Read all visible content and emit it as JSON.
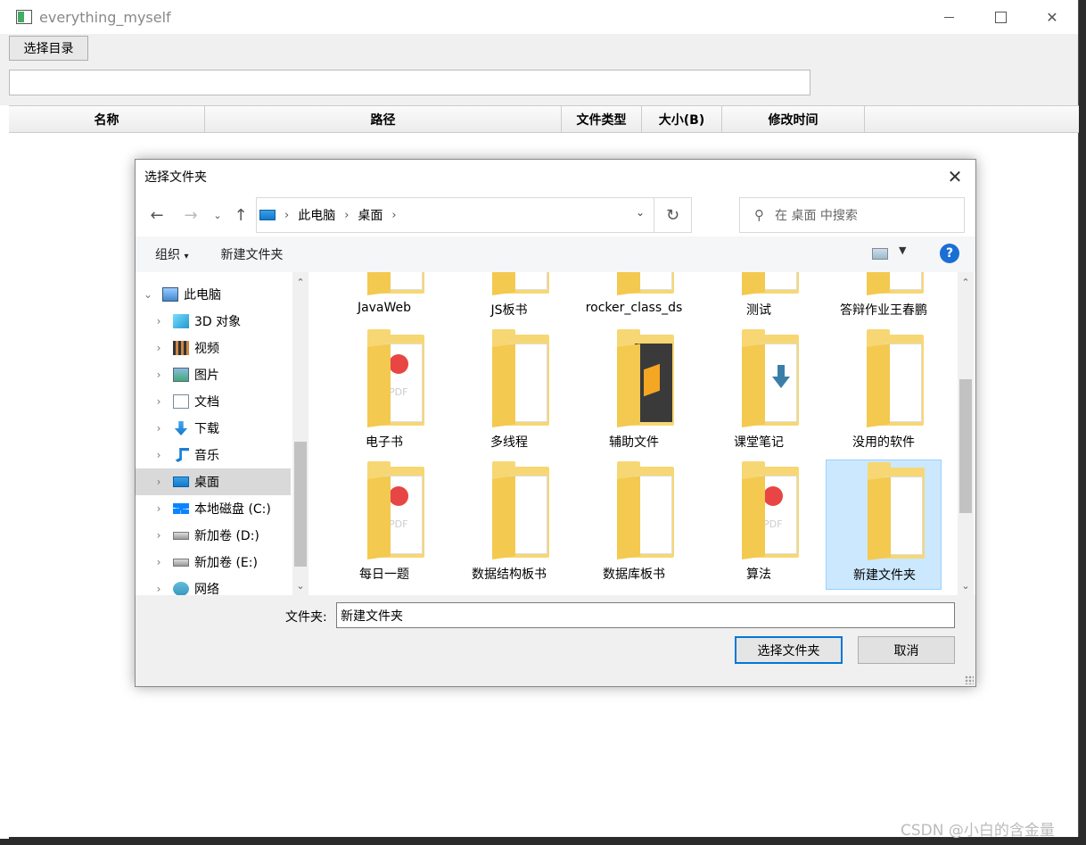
{
  "window": {
    "title": "everything_myself",
    "select_dir_label": "选择目录",
    "columns": [
      "名称",
      "路径",
      "文件类型",
      "大小(B)",
      "修改时间"
    ]
  },
  "dialog": {
    "title": "选择文件夹",
    "breadcrumb": [
      "此电脑",
      "桌面"
    ],
    "search_placeholder": "在 桌面 中搜索",
    "commands": {
      "organize": "组织",
      "new_folder": "新建文件夹"
    },
    "help_glyph": "?",
    "nav_tree": [
      {
        "label": "此电脑",
        "icon": "computer-icon",
        "expanded": true
      },
      {
        "label": "3D 对象",
        "icon": "cube-icon"
      },
      {
        "label": "视频",
        "icon": "video-icon"
      },
      {
        "label": "图片",
        "icon": "picture-icon"
      },
      {
        "label": "文档",
        "icon": "document-icon"
      },
      {
        "label": "下载",
        "icon": "download-icon"
      },
      {
        "label": "音乐",
        "icon": "music-icon"
      },
      {
        "label": "桌面",
        "icon": "desktop-icon",
        "selected": true
      },
      {
        "label": "本地磁盘 (C:)",
        "icon": "windows-drive-icon"
      },
      {
        "label": "新加卷 (D:)",
        "icon": "drive-icon"
      },
      {
        "label": "新加卷 (E:)",
        "icon": "drive-icon"
      },
      {
        "label": "网络",
        "icon": "network-icon"
      }
    ],
    "files": [
      {
        "label": "JavaWeb",
        "icon": "folder-icon"
      },
      {
        "label": "JS板书",
        "icon": "folder-icon"
      },
      {
        "label": "rocker_class_ds",
        "icon": "folder-icon"
      },
      {
        "label": "测试",
        "icon": "folder-icon"
      },
      {
        "label": "答辩作业王春鹏",
        "icon": "folder-icon"
      },
      {
        "label": "电子书",
        "icon": "folder-pdf-icon"
      },
      {
        "label": "多线程",
        "icon": "folder-icon"
      },
      {
        "label": "辅助文件",
        "icon": "folder-sublime-icon"
      },
      {
        "label": "课堂笔记",
        "icon": "folder-download-icon"
      },
      {
        "label": "没用的软件",
        "icon": "folder-icon"
      },
      {
        "label": "每日一题",
        "icon": "folder-pdf-icon"
      },
      {
        "label": "数据结构板书",
        "icon": "folder-icon"
      },
      {
        "label": "数据库板书",
        "icon": "folder-icon"
      },
      {
        "label": "算法",
        "icon": "folder-pdf-icon"
      },
      {
        "label": "新建文件夹",
        "icon": "folder-icon",
        "selected": true
      }
    ],
    "folder_field_label": "文件夹:",
    "folder_field_value": "新建文件夹",
    "ok_label": "选择文件夹",
    "cancel_label": "取消"
  },
  "watermark": "CSDN @小白的含金量",
  "colors": {
    "accent": "#0078d7",
    "selection": "#cce8ff",
    "folder": "#f7d774"
  }
}
